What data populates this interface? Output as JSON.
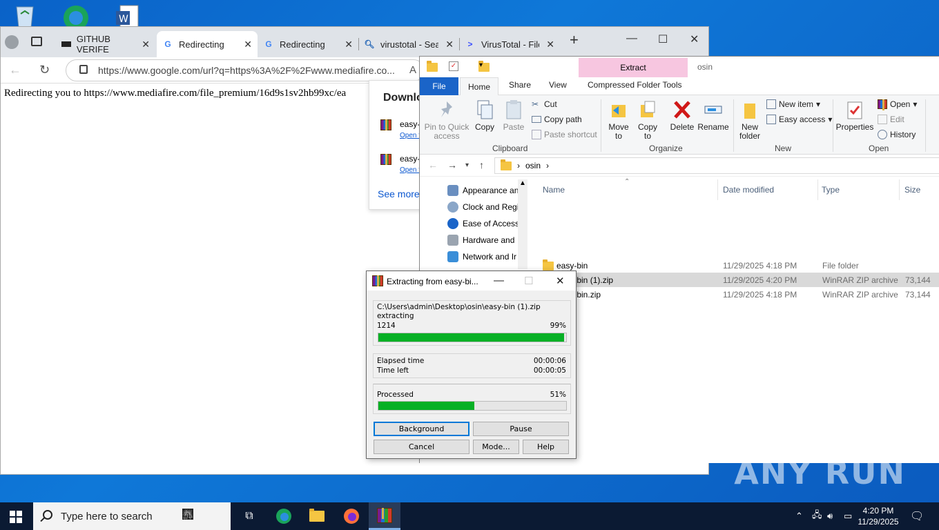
{
  "browser": {
    "tabs": [
      {
        "title": "GITHUB VERIFE"
      },
      {
        "title": "Redirecting"
      },
      {
        "title": "Redirecting"
      },
      {
        "title": "virustotal - Sear"
      },
      {
        "title": "VirusTotal - File"
      }
    ],
    "new_tab_label": "+",
    "url": "https://www.google.com/url?q=https%3A%2F%2Fwww.mediafire.co...",
    "page_text": "Redirecting you to https://www.mediafire.com/file_premium/16d9s1sv2hb99xc/ea",
    "downloads": {
      "title": "Downlo",
      "items": [
        {
          "name": "easy-",
          "link": "Open f"
        },
        {
          "name": "easy-",
          "link": "Open f"
        }
      ],
      "see_more": "See more"
    }
  },
  "explorer": {
    "context_tab": "Extract",
    "window_title": "osin",
    "ribbon_tabs": [
      "File",
      "Home",
      "Share",
      "View",
      "Compressed Folder Tools"
    ],
    "clipboard": {
      "pin": "Pin to Quick access",
      "copy": "Copy",
      "paste": "Paste",
      "cut": "Cut",
      "copy_path": "Copy path",
      "paste_shortcut": "Paste shortcut",
      "label": "Clipboard"
    },
    "organize": {
      "move_to": "Move to",
      "copy_to": "Copy to",
      "delete": "Delete",
      "rename": "Rename",
      "label": "Organize"
    },
    "new": {
      "new_folder": "New folder",
      "new_item": "New item",
      "easy_access": "Easy access",
      "label": "New"
    },
    "open": {
      "properties": "Properties",
      "open": "Open",
      "edit": "Edit",
      "history": "History",
      "label": "Open"
    },
    "path": "osin",
    "nav_items": [
      "Appearance an",
      "Clock and Regi",
      "Ease of Access",
      "Hardware and",
      "Network and Ir"
    ],
    "columns": [
      "Name",
      "Date modified",
      "Type",
      "Size"
    ],
    "files": [
      {
        "name": "easy-bin",
        "date": "11/29/2025 4:18 PM",
        "type": "File folder",
        "size": ""
      },
      {
        "name": "easy-bin (1).zip",
        "date": "11/29/2025 4:20 PM",
        "type": "WinRAR ZIP archive",
        "size": "73,144"
      },
      {
        "name": "easy-bin.zip",
        "date": "11/29/2025 4:18 PM",
        "type": "WinRAR ZIP archive",
        "size": "73,144"
      }
    ]
  },
  "winrar": {
    "title": "Extracting from easy-bi...",
    "archive_path": "C:\\Users\\admin\\Desktop\\osin\\easy-bin (1).zip",
    "action": "extracting",
    "file_count": "1214",
    "file_percent_label": "99%",
    "file_progress": 0.99,
    "elapsed_label": "Elapsed time",
    "elapsed": "00:00:06",
    "left_label": "Time left",
    "left": "00:00:05",
    "processed_label": "Processed",
    "processed_percent_label": "51%",
    "processed_progress": 0.51,
    "buttons": {
      "background": "Background",
      "pause": "Pause",
      "cancel": "Cancel",
      "mode": "Mode...",
      "help": "Help"
    }
  },
  "taskbar": {
    "search_placeholder": "Type here to search",
    "time": "4:20 PM",
    "date": "11/29/2025"
  },
  "watermark": "ANY RUN"
}
